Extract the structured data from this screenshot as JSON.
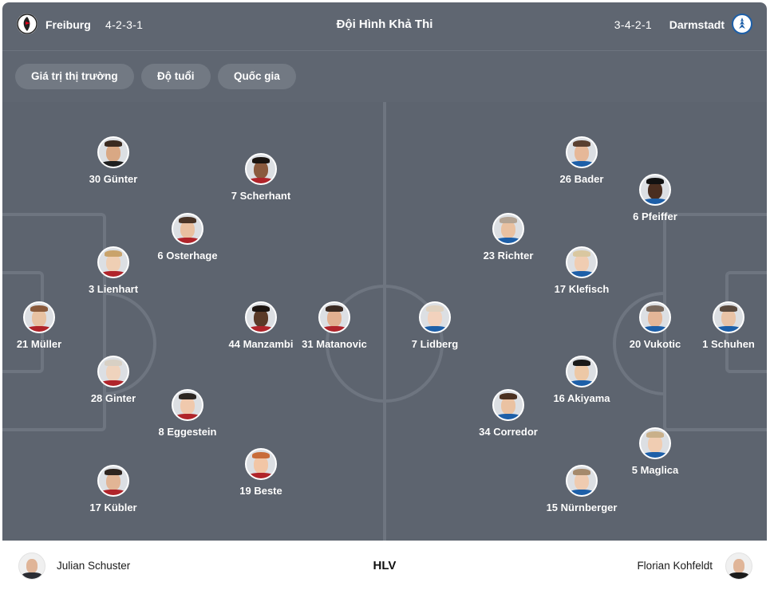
{
  "header": {
    "home_team": "Freiburg",
    "home_formation": "4-2-3-1",
    "title": "Đội Hình Khả Thi",
    "away_formation": "3-4-2-1",
    "away_team": "Darmstadt"
  },
  "filters": [
    "Giá trị thị trường",
    "Độ tuổi",
    "Quốc gia"
  ],
  "home_players": [
    {
      "label": "21 Müller",
      "number": "21"
    },
    {
      "label": "30 Günter",
      "number": "30"
    },
    {
      "label": "3 Lienhart",
      "number": "3"
    },
    {
      "label": "28 Ginter",
      "number": "28"
    },
    {
      "label": "17 Kübler",
      "number": "17"
    },
    {
      "label": "6 Osterhage",
      "number": "6"
    },
    {
      "label": "8 Eggestein",
      "number": "8"
    },
    {
      "label": "7 Scherhant",
      "number": "7"
    },
    {
      "label": "44 Manzambi",
      "number": "44"
    },
    {
      "label": "19 Beste",
      "number": "19"
    },
    {
      "label": "31 Matanovic",
      "number": "31"
    }
  ],
  "away_players": [
    {
      "label": "1 Schuhen",
      "number": "1"
    },
    {
      "label": "6 Pfeiffer",
      "number": "6"
    },
    {
      "label": "20 Vukotic",
      "number": "20"
    },
    {
      "label": "5 Maglica",
      "number": "5"
    },
    {
      "label": "26 Bader",
      "number": "26"
    },
    {
      "label": "17 Klefisch",
      "number": "17"
    },
    {
      "label": "16 Akiyama",
      "number": "16"
    },
    {
      "label": "15 Nürnberger",
      "number": "15"
    },
    {
      "label": "23 Richter",
      "number": "23"
    },
    {
      "label": "34 Corredor",
      "number": "34"
    },
    {
      "label": "7 Lidberg",
      "number": "7"
    }
  ],
  "coaches": {
    "home": "Julian Schuster",
    "label": "HLV",
    "away": "Florian Kohfeldt"
  },
  "colors": {
    "header_bg": "#5f6671",
    "pitch_bg": "#5d646f",
    "pitch_lines": "#6e7580",
    "chip_bg": "#727983",
    "darmstadt_blue": "#1d5fa8"
  },
  "icons": {
    "home_crest": "freiburg-crest-icon",
    "away_crest": "darmstadt-crest-icon"
  }
}
